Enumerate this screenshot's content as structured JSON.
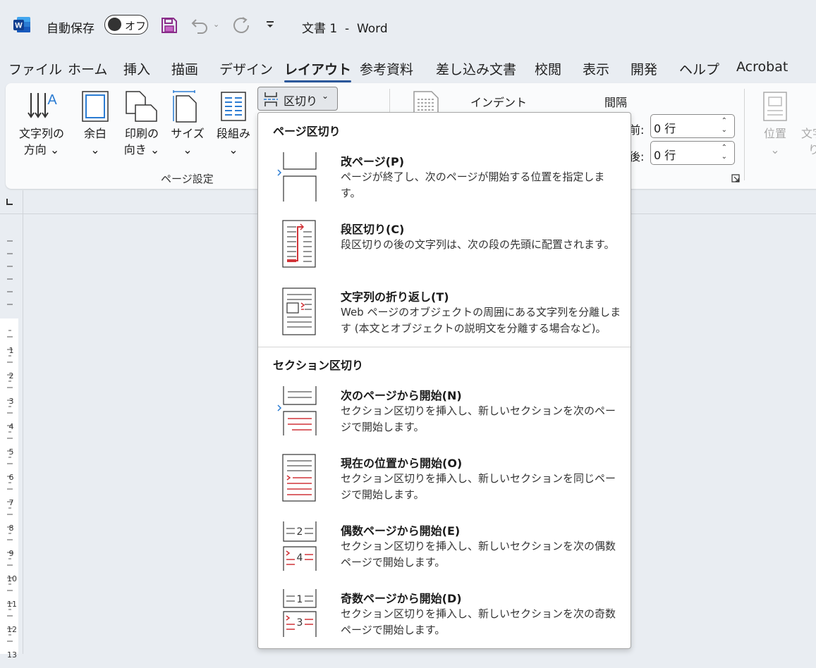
{
  "titlebar": {
    "autosave_label": "自動保存",
    "autosave_state": "オフ",
    "doc_title": "文書 1  -  Word"
  },
  "menu": {
    "tabs": [
      "ファイル",
      "ホーム",
      "挿入",
      "描画",
      "デザイン",
      "レイアウト",
      "参考資料",
      "差し込み文書",
      "校閲",
      "表示",
      "開発",
      "ヘルプ",
      "Acrobat"
    ],
    "active_tab": "レイアウト"
  },
  "ribbon": {
    "page_setup": {
      "text_direction": [
        "文字列の",
        "方向 ⌄"
      ],
      "margins": [
        "余白",
        "⌄"
      ],
      "orientation": [
        "印刷の",
        "向き ⌄"
      ],
      "size": [
        "サイズ",
        "⌄"
      ],
      "columns": [
        "段組み",
        "⌄"
      ],
      "breaks": "区切り",
      "group_label": "ページ設定"
    },
    "paragraph": {
      "indent_label": "インデント",
      "spacing_label": "間隔",
      "before_label": "前:",
      "after_label": "後:",
      "before_value": "0 行",
      "after_value": "0 行"
    },
    "arrange": {
      "position": [
        "位置",
        "⌄"
      ],
      "wrap_text_partial": [
        "文字",
        "り"
      ]
    }
  },
  "ruler": {
    "numbers": [
      "1",
      "1",
      "2",
      "3",
      "4",
      "5",
      "6",
      "7",
      "8",
      "9",
      "10",
      "11",
      "12",
      "13"
    ]
  },
  "dropdown": {
    "page_breaks_heading": "ページ区切り",
    "section_breaks_heading": "セクション区切り",
    "items": [
      {
        "title": "改ページ(P)",
        "desc": "ページが終了し、次のページが開始する位置を指定します。"
      },
      {
        "title": "段区切り(C)",
        "desc": "段区切りの後の文字列は、次の段の先頭に配置されます。"
      },
      {
        "title": "文字列の折り返し(T)",
        "desc": "Web ページのオブジェクトの周囲にある文字列を分離します (本文とオブジェクトの説明文を分離する場合など)。"
      },
      {
        "title": "次のページから開始(N)",
        "desc": "セクション区切りを挿入し、新しいセクションを次のページで開始します。"
      },
      {
        "title": "現在の位置から開始(O)",
        "desc": "セクション区切りを挿入し、新しいセクションを同じページで開始します。"
      },
      {
        "title": "偶数ページから開始(E)",
        "desc": "セクション区切りを挿入し、新しいセクションを次の偶数ページで開始します。"
      },
      {
        "title": "奇数ページから開始(D)",
        "desc": "セクション区切りを挿入し、新しいセクションを次の奇数ページで開始します。"
      }
    ],
    "icon_numbers": {
      "even_top": "2",
      "even_bottom": "4",
      "odd_top": "1",
      "odd_bottom": "3"
    }
  },
  "colors": {
    "accent": "#2b579a",
    "red": "#d13438",
    "background": "#e9edf2"
  }
}
